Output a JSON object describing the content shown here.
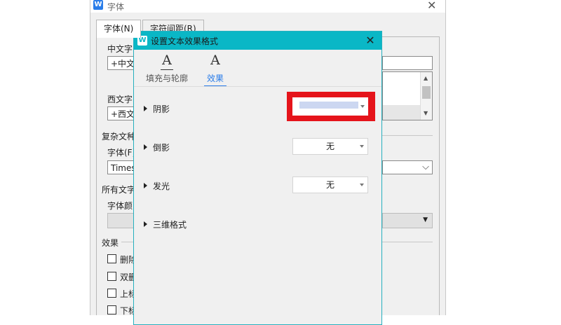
{
  "font_dialog": {
    "title": "字体",
    "tabs": [
      {
        "label": "字体(N)",
        "active": true
      },
      {
        "label": "字符间距(R)",
        "active": false
      }
    ],
    "chinese_font_label": "中文字",
    "chinese_font_value": "+中文",
    "western_font_label": "西文字",
    "western_font_value": "+西文",
    "complex_script_label": "复杂文种",
    "complex_font_label": "字体(F)",
    "complex_font_value": "Times",
    "all_text_label": "所有文字",
    "font_color_label": "字体颜",
    "effects_label": "效果",
    "checkboxes": [
      {
        "label": "删除"
      },
      {
        "label": "双删"
      },
      {
        "label": "上标"
      },
      {
        "label": "下标"
      }
    ]
  },
  "effect_dialog": {
    "title": "设置文本效果格式",
    "tabs": [
      {
        "label": "填充与轮廓",
        "active": false
      },
      {
        "label": "效果",
        "active": true
      }
    ],
    "sections": [
      {
        "label": "阴影",
        "value": ""
      },
      {
        "label": "倒影",
        "value": "无"
      },
      {
        "label": "发光",
        "value": "无"
      },
      {
        "label": "三维格式"
      }
    ]
  },
  "colors": {
    "titlebar": "#0ab7c6",
    "highlight_box": "#e5141b",
    "active_tab": "#2b7de9",
    "shadow_preview": "#ccd7f1"
  }
}
